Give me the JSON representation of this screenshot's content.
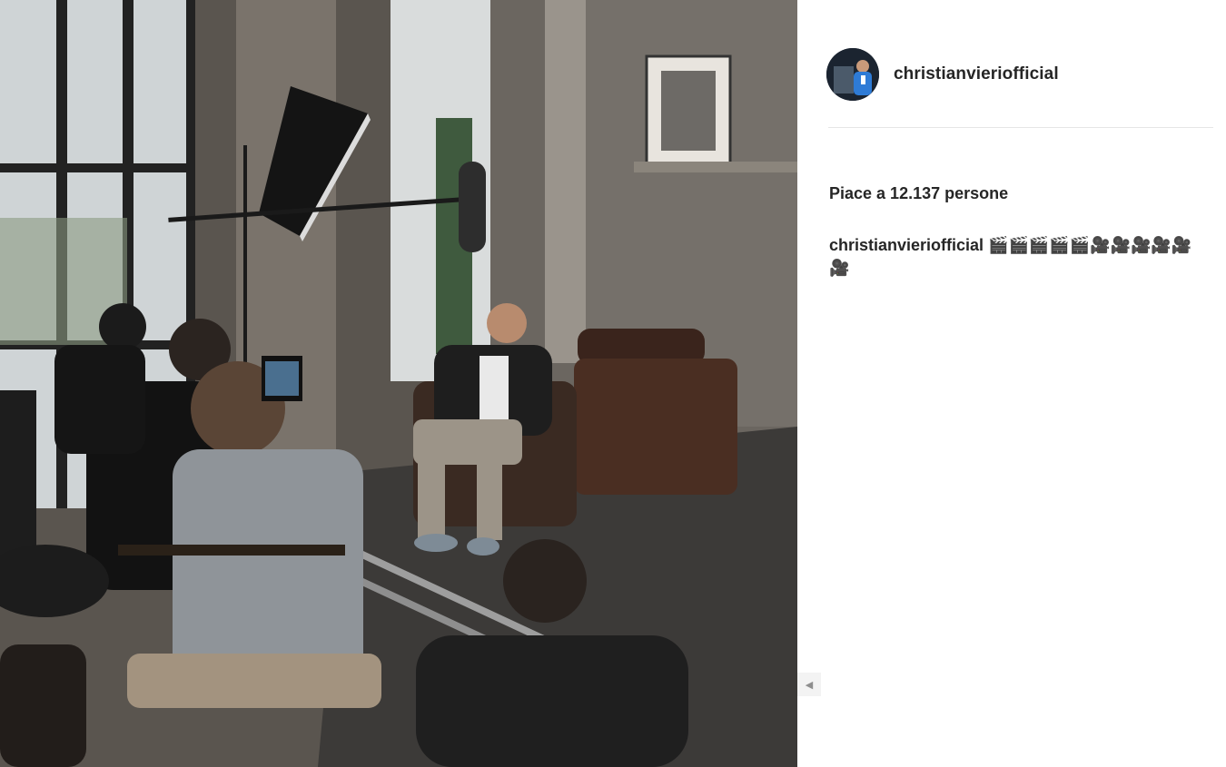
{
  "post": {
    "username": "christianvieriofficial",
    "likes_text": "Piace a 12.137 persone",
    "caption_author": "christianvieriofficial",
    "caption_text": "🎬🎬🎬🎬🎬🎥🎥🎥🎥🎥🎥",
    "avatar_icon": "profile-avatar",
    "prev_arrow_icon": "chevron-left-icon"
  },
  "photo": {
    "subject": "film crew interviewing a man in a leather armchair"
  }
}
